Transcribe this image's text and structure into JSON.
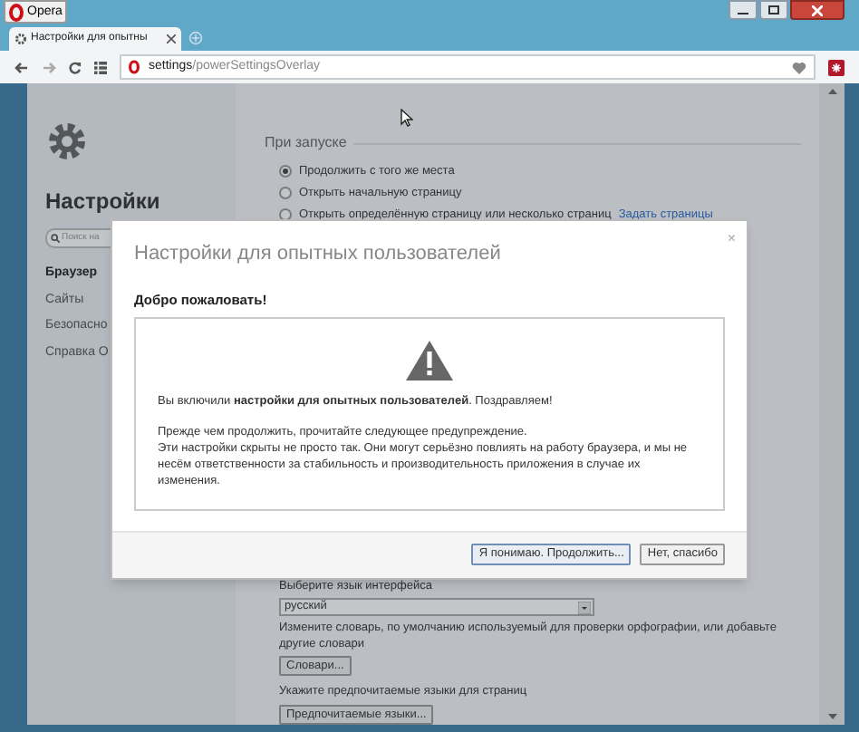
{
  "browser": {
    "menu_button": "Opera",
    "tab": {
      "title": "Настройки для опытны"
    },
    "address": {
      "host": "settings",
      "path": "/powerSettingsOverlay"
    }
  },
  "sidebar": {
    "title": "Настройки",
    "search": {
      "placeholder": "Поиск на"
    },
    "items": [
      {
        "label": "Браузер",
        "selected": true
      },
      {
        "label": "Сайты",
        "selected": false
      },
      {
        "label": "Безопасно",
        "selected": false
      },
      {
        "label": "Справка О",
        "selected": false
      }
    ]
  },
  "startup": {
    "heading": "При запуске",
    "options": [
      {
        "label": "Продолжить с того же места",
        "selected": true
      },
      {
        "label": "Открыть начальную страницу",
        "selected": false
      },
      {
        "label": "Открыть определённую страницу или несколько страниц",
        "selected": false
      }
    ],
    "link": "Задать страницы"
  },
  "language": {
    "label": "Выберите язык интерфейса",
    "value": "русский",
    "dictionary_hint": "Измените словарь, по умолчанию используемый для проверки орфографии, или добавьте другие словари",
    "dictionaries_button": "Словари...",
    "preferred_hint": "Укажите предпочитаемые языки для страниц",
    "preferred_button": "Предпочитаемые языки..."
  },
  "dialog": {
    "title": "Настройки для опытных пользователей",
    "close": "×",
    "welcome": "Добро пожаловать!",
    "message": "Вы включили **настройки для опытных пользователей**. Поздравляем!",
    "warning_lines": [
      "Прежде чем продолжить, прочитайте следующее предупреждение.",
      "Эти настройки скрыты не просто так. Они могут серьёзно повлиять на работу браузера, и мы не несём ответственности за стабильность и производительность приложения в случае их изменения."
    ],
    "buttons": [
      {
        "label": "Я понимаю. Продолжить...",
        "kind": "primary"
      },
      {
        "label": "Нет, спасибо",
        "kind": "secondary"
      }
    ]
  }
}
